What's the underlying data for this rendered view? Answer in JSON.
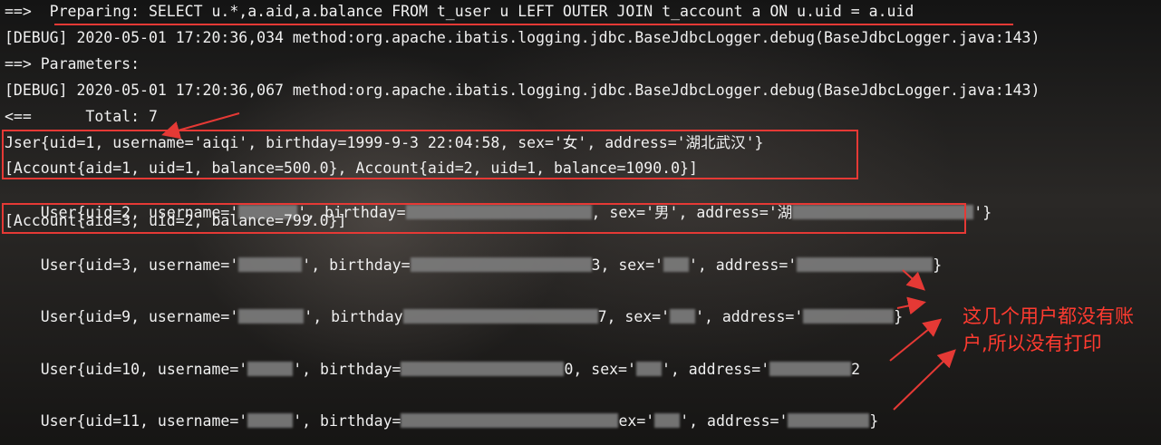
{
  "console": {
    "line1": "==>  Preparing: SELECT u.*,a.aid,a.balance FROM t_user u LEFT OUTER JOIN t_account a ON u.uid = a.uid",
    "line2": "[DEBUG] 2020-05-01 17:20:36,034 method:org.apache.ibatis.logging.jdbc.BaseJdbcLogger.debug(BaseJdbcLogger.java:143)",
    "line3": "==> Parameters:",
    "line4": "[DEBUG] 2020-05-01 17:20:36,067 method:org.apache.ibatis.logging.jdbc.BaseJdbcLogger.debug(BaseJdbcLogger.java:143)",
    "line5": "<==      Total: 7",
    "line6": "Jser{uid=1, username='aiqi', birthday=1999-9-3 22:04:58, sex='女', address='湖北武汉'}",
    "line7": "[Account{aid=1, uid=1, balance=500.0}, Account{aid=2, uid=1, balance=1090.0}]",
    "line8": {
      "a": "User{uid=2, username='",
      "b": "', birthday=",
      "c": ", sex='男', address='湖",
      "d": "'}"
    },
    "line9": "[Account{aid=3, uid=2, balance=799.0}]",
    "line10": {
      "a": "User{uid=3, username='",
      "b": "', birthday=",
      "c": "3, sex='",
      "d": "', address='",
      "e": "}"
    },
    "line11": {
      "a": "User{uid=9, username='",
      "b": "', birthday",
      "c": "7, sex='",
      "d": "', address='",
      "e": "}"
    },
    "line12": {
      "a": "User{uid=10, username='",
      "b": "', birthday=",
      "c": "0, sex='",
      "d": "', address='",
      "e": "2"
    },
    "line13": {
      "a": "User{uid=11, username='",
      "b": "', birthday=",
      "c": "ex='",
      "d": "', address='",
      "e": "}"
    }
  },
  "annotation": {
    "note": "这几个用户都没有账户,所以没有打印",
    "color": "#e53935"
  }
}
